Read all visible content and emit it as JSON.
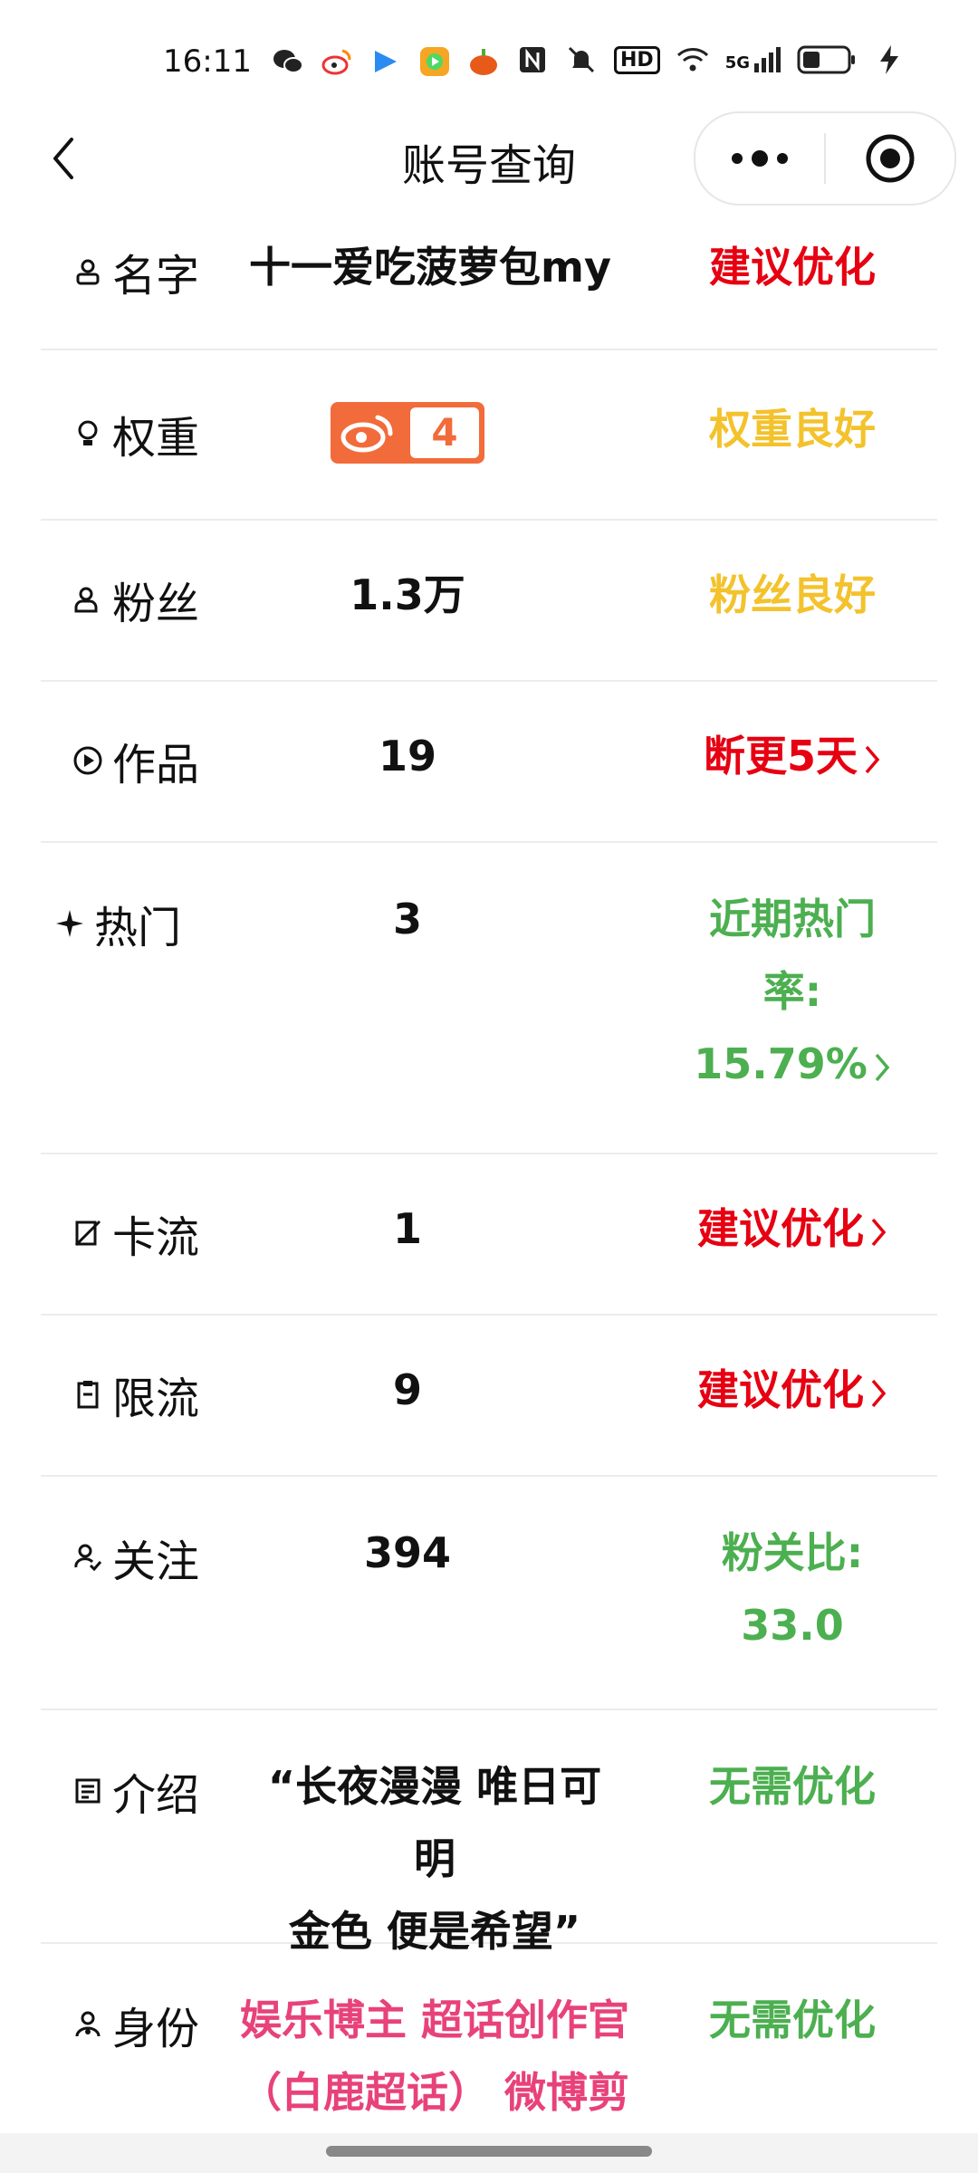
{
  "status_bar": {
    "time": "16:11",
    "icons_left": [
      "wechat-icon",
      "weibo-icon",
      "play-arrow-icon",
      "video-app-icon",
      "pumpkin-app-icon",
      "dot-icon"
    ],
    "icons_right": [
      "nfc-icon",
      "mute-icon",
      "hd-icon",
      "wifi-icon",
      "5g-signal-icon",
      "battery-icon",
      "charging-icon"
    ],
    "hd_label": "HD",
    "fiveg_label": "5G"
  },
  "header": {
    "title": "账号查询"
  },
  "rows": {
    "name": {
      "label": "名字",
      "value": "十一爱吃菠萝包my",
      "status": "建议优化"
    },
    "weight": {
      "label": "权重",
      "badge_value": "4",
      "status": "权重良好"
    },
    "fans": {
      "label": "粉丝",
      "value": "1.3万",
      "status": "粉丝良好"
    },
    "works": {
      "label": "作品",
      "value": "19",
      "status": "断更5天"
    },
    "hot": {
      "label": "热门",
      "value": "3",
      "status_line1": "近期热门",
      "status_line2": "率:",
      "status_line3": "15.79%"
    },
    "stuck": {
      "label": "卡流",
      "value": "1",
      "status": "建议优化"
    },
    "limit": {
      "label": "限流",
      "value": "9",
      "status": "建议优化"
    },
    "follow": {
      "label": "关注",
      "value": "394",
      "status_line1": "粉关比:",
      "status_line2": "33.0"
    },
    "intro": {
      "label": "介绍",
      "value_line1": "“长夜漫漫 唯日可明",
      "value_line2": "金色 便是希望”",
      "status": "无需优化"
    },
    "identity": {
      "label": "身份",
      "value_line1": "娱乐博主 超话创作官",
      "value_line2": "（白鹿超话） 微博剪",
      "status": "无需优化"
    }
  },
  "colors": {
    "red": "#e60012",
    "yellow": "#f3c22c",
    "green": "#4caf50",
    "pink": "#e8427a",
    "badge_orange": "#f26b3a"
  }
}
